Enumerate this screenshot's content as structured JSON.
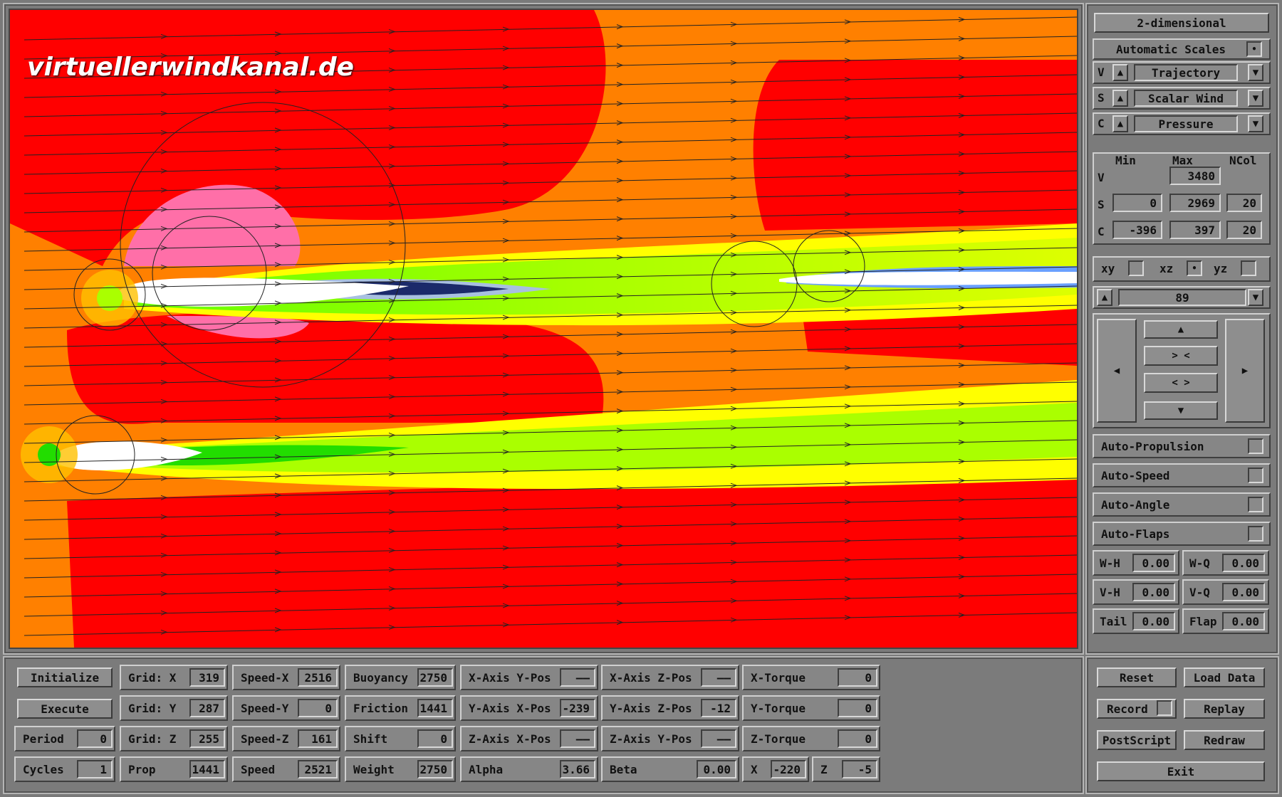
{
  "watermark": "virtuellerwindkanal.de",
  "right_panel": {
    "dimension_button": "2-dimensional",
    "auto_scales_label": "Automatic Scales",
    "auto_scales_checked": "•",
    "rows": [
      {
        "letter": "V",
        "value": "Trajectory"
      },
      {
        "letter": "S",
        "value": "Scalar Wind"
      },
      {
        "letter": "C",
        "value": "Pressure"
      }
    ],
    "range_headers": {
      "min": "Min",
      "max": "Max",
      "ncol": "NCol"
    },
    "range_rows": [
      {
        "letter": "V",
        "min": "",
        "max": "3480",
        "ncol": ""
      },
      {
        "letter": "S",
        "min": "0",
        "max": "2969",
        "ncol": "20"
      },
      {
        "letter": "C",
        "min": "-396",
        "max": "397",
        "ncol": "20"
      }
    ],
    "planes": [
      {
        "label": "xy",
        "checked": ""
      },
      {
        "label": "xz",
        "checked": "•"
      },
      {
        "label": "yz",
        "checked": ""
      }
    ],
    "slice_value": "89",
    "nav": {
      "up": "▲",
      "zoom_in": "> <",
      "zoom_out": "< >",
      "down": "▼",
      "left": "◀",
      "right": "▶"
    },
    "toggles": [
      "Auto-Propulsion",
      "Auto-Speed",
      "Auto-Angle",
      "Auto-Flaps"
    ],
    "flaps": [
      {
        "label": "W-H",
        "value": "0.00"
      },
      {
        "label": "W-Q",
        "value": "0.00"
      },
      {
        "label": "V-H",
        "value": "0.00"
      },
      {
        "label": "V-Q",
        "value": "0.00"
      },
      {
        "label": "Tail",
        "value": "0.00"
      },
      {
        "label": "Flap",
        "value": "0.00"
      }
    ],
    "actions": {
      "reset": "Reset",
      "load_data": "Load Data",
      "record": "Record",
      "replay": "Replay",
      "postscript": "PostScript",
      "redraw": "Redraw",
      "exit": "Exit"
    }
  },
  "bottom": {
    "col1": [
      "Initialize",
      "Execute"
    ],
    "period": {
      "label": "Period",
      "value": "0"
    },
    "cycles": {
      "label": "Cycles",
      "value": "1"
    },
    "col2": [
      {
        "label": "Grid: X",
        "value": "319"
      },
      {
        "label": "Grid: Y",
        "value": "287"
      },
      {
        "label": "Grid: Z",
        "value": "255"
      },
      {
        "label": "Prop",
        "value": "1441"
      }
    ],
    "col3": [
      {
        "label": "Speed-X",
        "value": "2516"
      },
      {
        "label": "Speed-Y",
        "value": "0"
      },
      {
        "label": "Speed-Z",
        "value": "161"
      },
      {
        "label": "Speed",
        "value": "2521"
      }
    ],
    "col4": [
      {
        "label": "Buoyancy",
        "value": "2750"
      },
      {
        "label": "Friction",
        "value": "1441"
      },
      {
        "label": "Shift",
        "value": "0"
      },
      {
        "label": "Weight",
        "value": "2750"
      }
    ],
    "col5": [
      {
        "label": "X-Axis Y-Pos",
        "value": "——"
      },
      {
        "label": "Y-Axis X-Pos",
        "value": "-239"
      },
      {
        "label": "Z-Axis X-Pos",
        "value": "——"
      }
    ],
    "col6": [
      {
        "label": "X-Axis Z-Pos",
        "value": "——"
      },
      {
        "label": "Y-Axis Z-Pos",
        "value": "-12"
      },
      {
        "label": "Z-Axis Y-Pos",
        "value": "——"
      }
    ],
    "col7": [
      {
        "label": "X-Torque",
        "value": "0"
      },
      {
        "label": "Y-Torque",
        "value": "0"
      },
      {
        "label": "Z-Torque",
        "value": "0"
      }
    ],
    "alpha": {
      "label": "Alpha",
      "value": "3.66"
    },
    "beta": {
      "label": "Beta",
      "value": "0.00"
    },
    "x": {
      "label": "X",
      "value": "-220"
    },
    "z": {
      "label": "Z",
      "value": "-5"
    }
  },
  "colors": {
    "red": "#ff0000",
    "orange": "#ff8000",
    "pink": "#ff6fa8",
    "yellow": "#ffff00",
    "green": "#22dd00",
    "panel": "#7b7b7b"
  }
}
